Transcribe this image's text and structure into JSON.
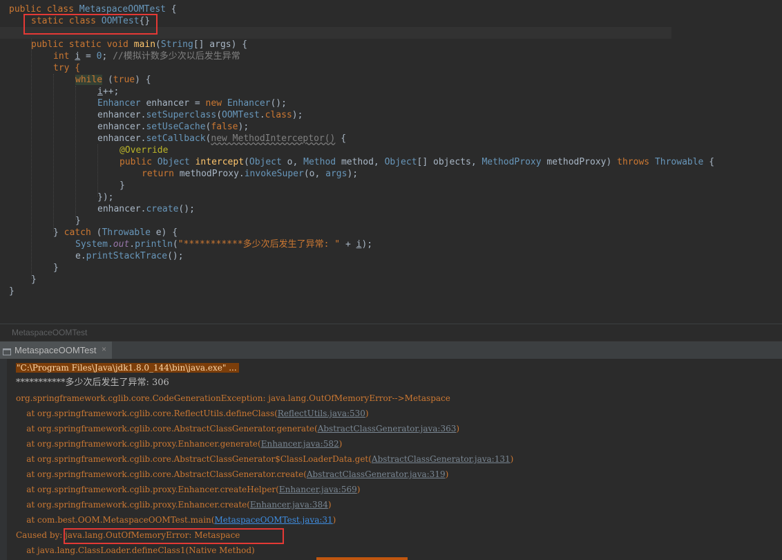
{
  "code": {
    "lines": [
      {
        "t1": "public class ",
        "t2": "MetaspaceOOMTest",
        " t3": " {"
      },
      {
        "t1": "static class ",
        "t2": "OOMTest",
        "t3": "{}"
      },
      {
        "t1": "public static void ",
        "t2": "main",
        "t3": "(",
        "t4": "String",
        "t5": "[] args) {"
      },
      {
        "t1": "int ",
        "t2": "i",
        "t3": " = ",
        "t4": "0",
        "t5": "; ",
        "t6": "//模拟计数多少次以后发生异常"
      },
      {
        "t1": "try {"
      },
      {
        "t1": "while",
        "t2": " (",
        "t3": "true",
        "t4": ") {"
      },
      {
        "t1": "i",
        "t2": "++;"
      },
      {
        "t1": "Enhancer",
        "t2": " enhancer = ",
        "t3": "new ",
        "t4": "Enhancer",
        "t5": "();"
      },
      {
        "t1": "enhancer.",
        "t2": "setSuperclass",
        "t3": "(",
        "t4": "OOMTest",
        "t5": ".",
        "t6": "class",
        "t7": ");"
      },
      {
        "t1": "enhancer.",
        "t2": "setUseCache",
        "t3": "(",
        "t4": "false",
        "t5": ");"
      },
      {
        "t1": "enhancer.",
        "t2": "setCallback",
        "t3": "(",
        "t4": "new MethodInterceptor()",
        "t5": " {"
      },
      {
        "t1": "@Override"
      },
      {
        "t1": "public ",
        "t2": "Object ",
        "t3": "intercept",
        "t4": "(",
        "t5": "Object",
        " t6": " o, ",
        "t7": "Method",
        " t8": " method, ",
        "t9": "Object",
        "t10": "[] objects, ",
        "t11": "MethodProxy",
        "t12": " methodProxy) ",
        "t13": "throws ",
        "t14": "Throwable",
        "t15": " {"
      },
      {
        "t1": "return ",
        "t2": "methodProxy.",
        "t3": "invokeSuper",
        "t4": "(o, ",
        "t5": "args",
        "t6": ");"
      },
      {
        "t1": "}"
      },
      {
        "t1": "});"
      },
      {
        "t1": "enhancer.",
        "t2": "create",
        "t3": "();"
      },
      {
        "t1": "}"
      },
      {
        "t1": "} ",
        "t2": "catch ",
        "t3": "(",
        "t4": "Throwable",
        " t5": " e) {"
      },
      {
        "t1": "System.",
        "t2": "out",
        "t3": ".",
        "t4": "println",
        "t5": "(",
        "t6": "\"***********多少次后发生了异常: \"",
        "t7": " + ",
        "t8": "i",
        "t9": ");"
      },
      {
        "t1": "e.",
        "t2": "printStackTrace",
        "t3": "();"
      },
      {
        "t1": "}"
      },
      {
        "t1": "}"
      },
      {
        "t1": "}"
      }
    ]
  },
  "breadcrumb": "MetaspaceOOMTest",
  "run_tab": {
    "label": "MetaspaceOOMTest",
    "close": "×"
  },
  "console": {
    "cmd": "\"C:\\Program Files\\Java\\jdk1.8.0_144\\bin\\java.exe\" ...",
    "result": "***********多少次后发生了异常: 306",
    "exception": "org.springframework.cglib.core.CodeGenerationException: java.lang.OutOfMemoryError-->Metaspace",
    "frames": [
      {
        "at": "    at org.springframework.cglib.core.ReflectUtils.defineClass(",
        "src": "ReflectUtils.java:530",
        "end": ")"
      },
      {
        "at": "    at org.springframework.cglib.core.AbstractClassGenerator.generate(",
        "src": "AbstractClassGenerator.java:363",
        "end": ")"
      },
      {
        "at": "    at org.springframework.cglib.proxy.Enhancer.generate(",
        "src": "Enhancer.java:582",
        "end": ")"
      },
      {
        "at": "    at org.springframework.cglib.core.AbstractClassGenerator$ClassLoaderData.get(",
        "src": "AbstractClassGenerator.java:131",
        "end": ")"
      },
      {
        "at": "    at org.springframework.cglib.core.AbstractClassGenerator.create(",
        "src": "AbstractClassGenerator.java:319",
        "end": ")"
      },
      {
        "at": "    at org.springframework.cglib.proxy.Enhancer.createHelper(",
        "src": "Enhancer.java:569",
        "end": ")"
      },
      {
        "at": "    at org.springframework.cglib.proxy.Enhancer.create(",
        "src": "Enhancer.java:384",
        "end": ")"
      },
      {
        "at": "    at com.best.OOM.MetaspaceOOMTest.main(",
        "src": "MetaspaceOOMTest.java:31",
        "end": ")"
      }
    ],
    "caused_prefix": "Caused by: ",
    "caused": "java.lang.OutOfMemoryError: Metaspace",
    "last_frame": "    at java.lang.ClassLoader.defineClass1(Native Method)"
  },
  "colors": {
    "keyword": "#cc7832",
    "type": "#6897bb",
    "string": "#6a8759",
    "highlight_box": "#e53935",
    "console_text": "#cc7832"
  }
}
